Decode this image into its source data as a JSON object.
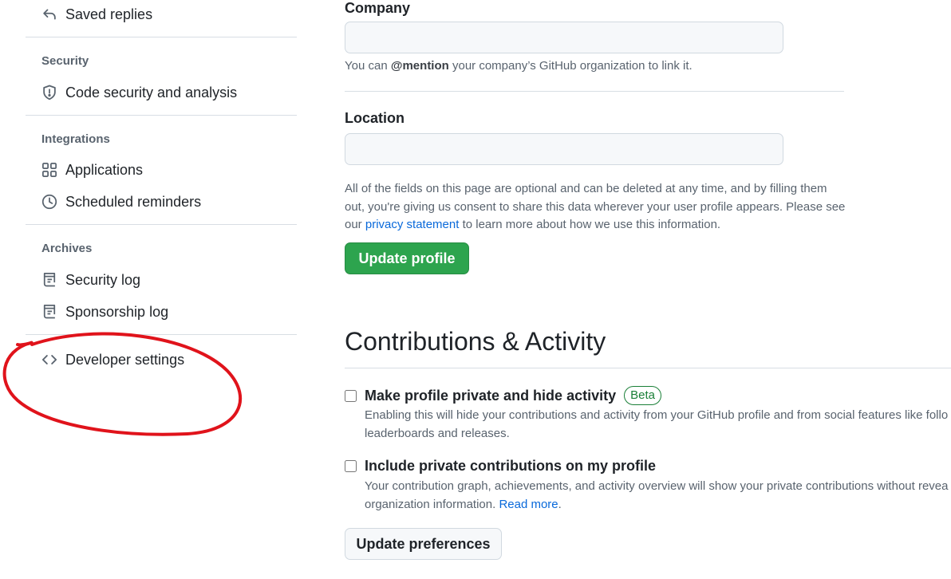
{
  "sidebar": {
    "items": [
      {
        "label": "Saved replies",
        "icon": "reply-icon"
      },
      {
        "label": "Code security and analysis",
        "icon": "shield-icon"
      },
      {
        "label": "Applications",
        "icon": "apps-grid-icon"
      },
      {
        "label": "Scheduled reminders",
        "icon": "clock-icon"
      },
      {
        "label": "Security log",
        "icon": "log-icon"
      },
      {
        "label": "Sponsorship log",
        "icon": "log-icon"
      },
      {
        "label": "Developer settings",
        "icon": "code-icon"
      }
    ],
    "headings": {
      "security": "Security",
      "integrations": "Integrations",
      "archives": "Archives"
    }
  },
  "form": {
    "company": {
      "label": "Company",
      "value": "",
      "note_prefix": "You can ",
      "note_mention": "@mention",
      "note_suffix": " your company’s GitHub organization to link it."
    },
    "location": {
      "label": "Location",
      "value": ""
    },
    "consent": {
      "line1": "All of the fields on this page are optional and can be deleted at any time, and by filling them",
      "line2": "out, you're giving us consent to share this data wherever your user profile appears. Please see",
      "line3_prefix": "our ",
      "link": "privacy statement",
      "line3_suffix": " to learn more about how we use this information."
    },
    "update_button": "Update profile"
  },
  "contributions": {
    "title": "Contributions & Activity",
    "private_profile": {
      "label": "Make profile private and hide activity",
      "badge": "Beta",
      "checked": false,
      "desc_line1": "Enabling this will hide your contributions and activity from your GitHub profile and from social features like follo",
      "desc_line2": "leaderboards and releases."
    },
    "private_contributions": {
      "label": "Include private contributions on my profile",
      "checked": false,
      "desc_line1": "Your contribution graph, achievements, and activity overview will show your private contributions without revea",
      "desc_line2_prefix": "organization information. ",
      "read_more": "Read more",
      "desc_line2_suffix": "."
    },
    "update_button": "Update preferences"
  },
  "colors": {
    "primary_button": "#2da44e",
    "link": "#0969da",
    "beta_badge": "#1a7f37",
    "annotation": "#e0131b"
  }
}
